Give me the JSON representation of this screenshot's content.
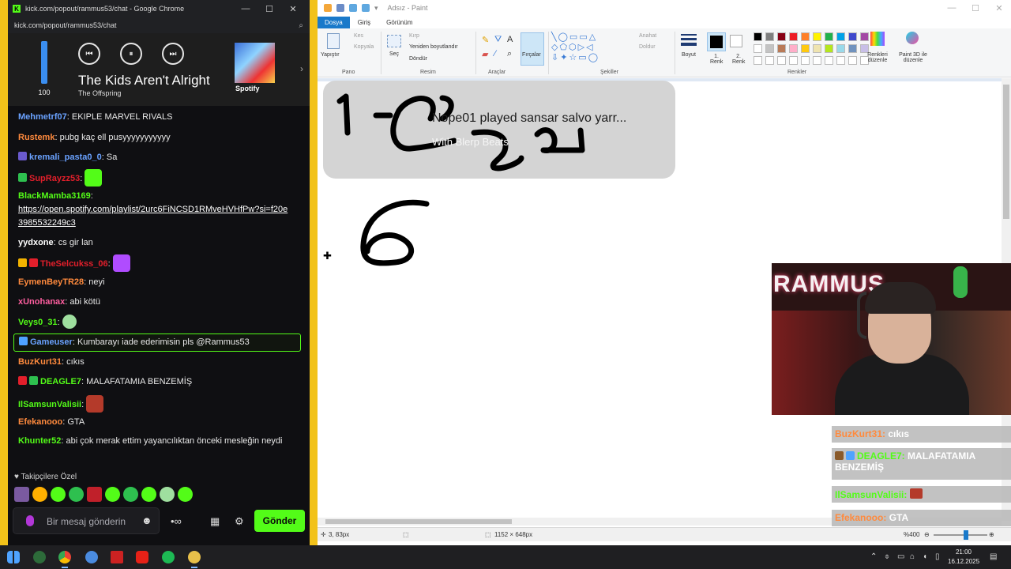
{
  "chrome": {
    "title": "kick.com/popout/rammus53/chat - Google Chrome",
    "url": "kick.com/popout/rammus53/chat",
    "minimize": "—",
    "maximize": "☐",
    "close": "✕"
  },
  "spotify": {
    "volume": "100",
    "volume_level": 1.0,
    "song": "The Kids Aren't Alright",
    "artist": "The Offspring",
    "brand": "Spotify",
    "prev_icon": "⏮",
    "play_icon": "⏸",
    "next_icon": "⏭"
  },
  "chat": {
    "messages": [
      {
        "user": "Mehmetrf07",
        "color": "#6aa2ff",
        "text": "EKIPLE MARVEL RIVALS"
      },
      {
        "user": "Rustemk",
        "color": "#ff8a3d",
        "text": "pubg kaç ell pusyyyyyyyyyyy"
      },
      {
        "user": "kremali_pasta0_0",
        "color": "#6aa2ff",
        "text": "Sa"
      },
      {
        "user": "SupRayzz53",
        "color": "#e21f2b",
        "text": ""
      },
      {
        "user": "BlackMamba3169",
        "color": "#53fc18",
        "text": "",
        "link": "https://open.spotify.com/playlist/2urc6FiNCSD1RMveHVHfPw?si=f20e3985532249c3"
      },
      {
        "user": "yydxone",
        "color": "#ffffff",
        "text": "cs gir lan"
      },
      {
        "user": "TheSelcukss_06",
        "color": "#e21f2b",
        "text": ""
      },
      {
        "user": "EymenBeyTR28",
        "color": "#ff8a3d",
        "text": "neyi"
      },
      {
        "user": "xUnohanax",
        "color": "#ff5fa0",
        "text": "abi kötü"
      },
      {
        "user": "Veys0_31",
        "color": "#53fc18",
        "text": ""
      },
      {
        "user": "Gameuser",
        "color": "#6aa2ff",
        "text": "Kumbarayı iade ederimisin pls @Rammus53"
      },
      {
        "user": "BuzKurt31",
        "color": "#ff8a3d",
        "text": "cıkıs"
      },
      {
        "user": "DEAGLE7",
        "color": "#53fc18",
        "text": "MALAFATAMIA BENZEMİŞ"
      },
      {
        "user": "IlSamsunValisii",
        "color": "#53fc18",
        "text": ""
      },
      {
        "user": "Efekanooo",
        "color": "#ff8a3d",
        "text": "GTA"
      },
      {
        "user": "Khunter52",
        "color": "#53fc18",
        "text": "abi çok merak ettim yayancılıktan önceki mesleğin neydi"
      }
    ],
    "followers_only": "Takipçilere Özel",
    "placeholder": "Bir mesaj gönderin",
    "send": "Gönder"
  },
  "paint": {
    "title": "Adsız - Paint",
    "menu": {
      "file": "Dosya",
      "home": "Giriş",
      "view": "Görünüm"
    },
    "ribbon": {
      "paste": "Yapıştır",
      "cut": "Kes",
      "copy": "Kopyala",
      "select": "Seç",
      "crop": "Kırp",
      "resize": "Yeniden boyutlandır",
      "rotate": "Döndür",
      "brushes": "Fırçalar",
      "outline": "Anahat",
      "fill": "Doldur",
      "size": "Boyut",
      "color1": "1. Renk",
      "color2": "2. Renk",
      "edit_colors": "Renkleri düzenle",
      "paint3d": "Paint 3D ile düzenle",
      "groups": {
        "clipboard": "Pano",
        "image": "Resim",
        "tools": "Araçlar",
        "shapes": "Şekiller",
        "colors": "Renkler"
      }
    },
    "palette": [
      "#000000",
      "#7f7f7f",
      "#880015",
      "#ed1c24",
      "#ff7f27",
      "#fff200",
      "#22b14c",
      "#00a2e8",
      "#3f48cc",
      "#a349a4",
      "#ffffff",
      "#c3c3c3",
      "#b97a57",
      "#ffaec9",
      "#ffc90e",
      "#efe4b0",
      "#b5e61d",
      "#99d9ea",
      "#7092be",
      "#c8bfe7"
    ],
    "status": {
      "cursor": "3, 83px",
      "size": "1152 × 648px",
      "zoom": "%400"
    }
  },
  "overlay": {
    "now_playing": "Nope01 played sansar salvo yarr...",
    "now_playing_sub": "With Blerp Beats",
    "webcam_sign": "RAMMUS",
    "chat": [
      {
        "user": "BuzKurt31:",
        "color": "#ff8a3d",
        "text": "cıkıs"
      },
      {
        "user": "DEAGLE7:",
        "color": "#53fc18",
        "text": "MALAFATAMIA"
      },
      {
        "user": "",
        "color": "#ffffff",
        "text": "BENZEMİŞ"
      },
      {
        "user": "IlSamsunValisii:",
        "color": "#53fc18",
        "text": ""
      },
      {
        "user": "Efekanooo:",
        "color": "#ff8a3d",
        "text": "GTA"
      }
    ]
  },
  "taskbar": {
    "time": "21:00",
    "date": "16.12.2025"
  }
}
